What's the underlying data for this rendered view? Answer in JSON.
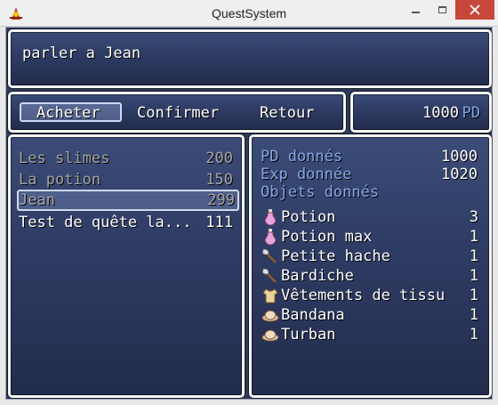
{
  "window": {
    "title": "QuestSystem"
  },
  "help": {
    "text": "parler a Jean"
  },
  "commands": [
    {
      "label": "Acheter",
      "selected": true
    },
    {
      "label": "Confirmer"
    },
    {
      "label": "Retour"
    }
  ],
  "gold": {
    "value": "1000",
    "unit": "PD"
  },
  "quests": [
    {
      "name": "Les slimes",
      "value": "200",
      "state": "dim"
    },
    {
      "name": "La potion",
      "value": "150",
      "state": "dim"
    },
    {
      "name": "Jean",
      "value": "299",
      "state": "selected"
    },
    {
      "name": "Test de quête la...",
      "value": "111",
      "state": "normal"
    }
  ],
  "details": {
    "pd_label": "PD donnés",
    "pd_value": "1000",
    "exp_label": "Exp donnée",
    "exp_value": "1020",
    "objects_label": "Objets donnés",
    "items": [
      {
        "icon": "potion-icon",
        "name": "Potion",
        "qty": "3"
      },
      {
        "icon": "potion-icon",
        "name": "Potion max",
        "qty": "1"
      },
      {
        "icon": "axe-icon",
        "name": "Petite hache",
        "qty": "1"
      },
      {
        "icon": "axe-icon",
        "name": "Bardiche",
        "qty": "1"
      },
      {
        "icon": "clothes-icon",
        "name": "Vêtements de tissu",
        "qty": "1"
      },
      {
        "icon": "hat-icon",
        "name": "Bandana",
        "qty": "1"
      },
      {
        "icon": "hat-icon",
        "name": "Turban",
        "qty": "1"
      }
    ]
  },
  "colors": {
    "window_bg": "#2e3b63",
    "system_blue": "#84a8e8",
    "close_red": "#c7473b"
  }
}
